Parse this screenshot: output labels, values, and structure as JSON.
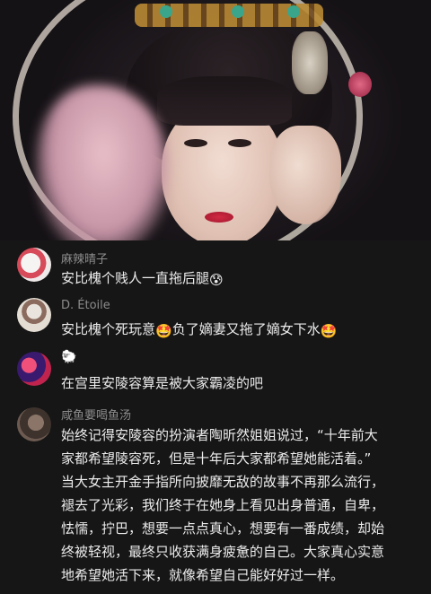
{
  "comments": [
    {
      "username": "麻辣晴子",
      "text": "安比槐个贱人一直拖后腿",
      "emoji": "😰"
    },
    {
      "username": "D. Étoile",
      "segments": [
        "安比槐个死玩意",
        "负了嫡妻又拖了嫡女下水"
      ],
      "emoji": "🤩"
    },
    {
      "username_icon": "🐑",
      "text": "在宫里安陵容算是被大家霸凌的吧"
    },
    {
      "username": "咸鱼要喝鱼汤",
      "lines": [
        "始终记得安陵容的扮演者陶昕然姐姐说过，“十年前大",
        "家都希望陵容死，但是十年后大家都希望她能活着。”",
        "当大女主开金手指所向披靡无敌的故事不再那么流行，",
        "褪去了光彩，我们终于在她身上看见出身普通，自卑，",
        "怯懦，拧巴，想要一点点真心，想要有一番成绩，却始",
        "终被轻视，最终只收获满身疲惫的自己。大家真心实意",
        "地希望她活下来，就像希望自己能好好过一样。"
      ]
    }
  ]
}
